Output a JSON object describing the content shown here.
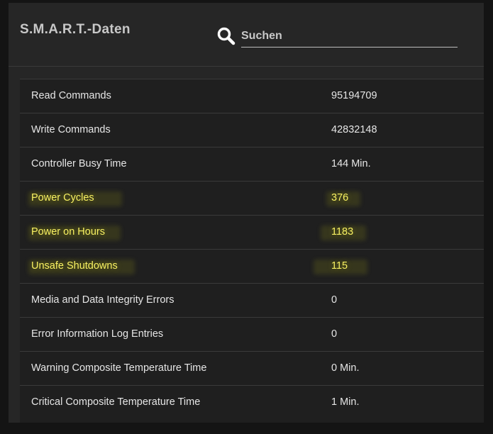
{
  "header": {
    "title": "S.M.A.R.T.-Daten",
    "search": {
      "placeholder": "Suchen",
      "value": "",
      "icon": "search-icon"
    }
  },
  "colors": {
    "highlight": "#f7f062",
    "text": "#e6e6e6",
    "panel": "#262626"
  },
  "rows": [
    {
      "name": "Read Commands",
      "value": "95194709",
      "highlighted": false
    },
    {
      "name": "Write Commands",
      "value": "42832148",
      "highlighted": false
    },
    {
      "name": "Controller Busy Time",
      "value": "144 Min.",
      "highlighted": false
    },
    {
      "name": "Power Cycles",
      "value": "376",
      "highlighted": true
    },
    {
      "name": "Power on Hours",
      "value": "1183",
      "highlighted": true
    },
    {
      "name": "Unsafe Shutdowns",
      "value": "115",
      "highlighted": true
    },
    {
      "name": "Media and Data Integrity Errors",
      "value": "0",
      "highlighted": false
    },
    {
      "name": "Error Information Log Entries",
      "value": "0",
      "highlighted": false
    },
    {
      "name": "Warning Composite Temperature Time",
      "value": "0 Min.",
      "highlighted": false
    },
    {
      "name": "Critical Composite Temperature Time",
      "value": "1 Min.",
      "highlighted": false
    }
  ]
}
